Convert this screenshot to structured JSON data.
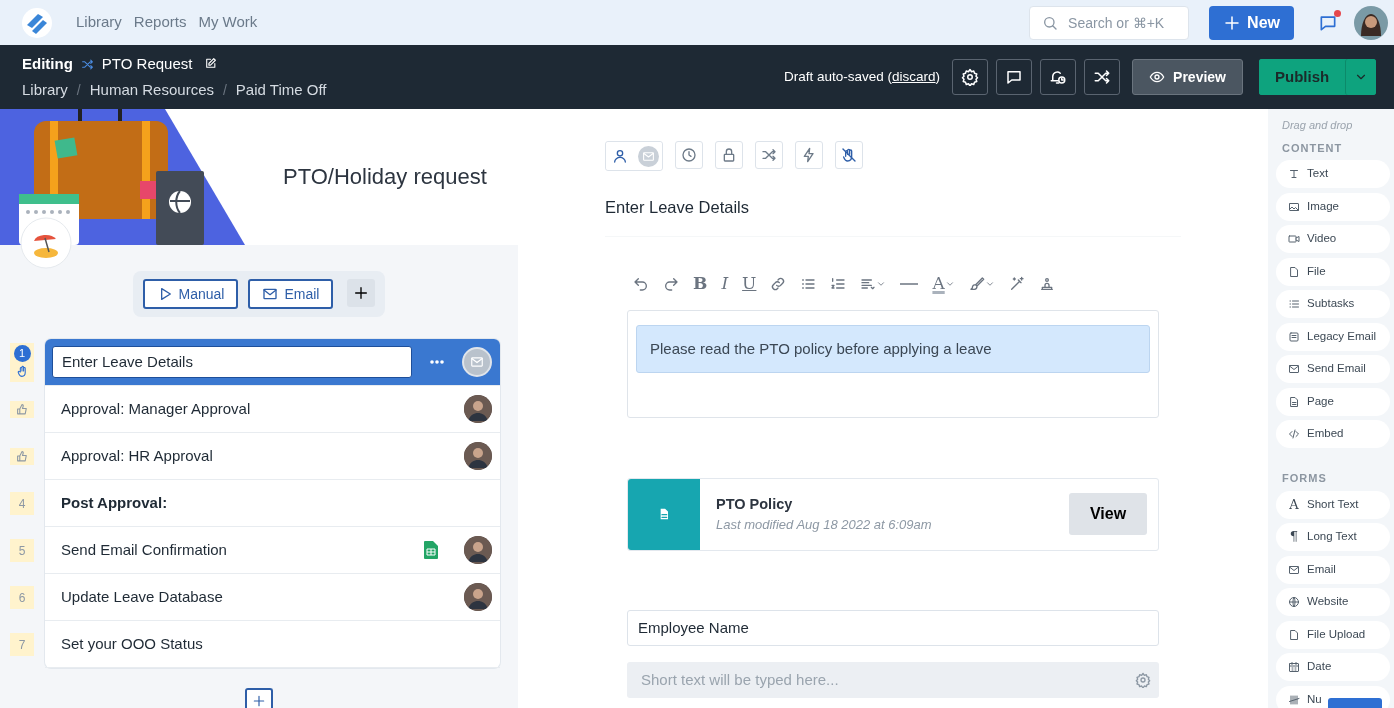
{
  "top_nav": {
    "links": [
      {
        "label": "Library",
        "selected": false
      },
      {
        "label": "Reports",
        "selected": false
      },
      {
        "label": "My Work",
        "selected": false
      }
    ],
    "search": {
      "placeholder": "Search or ⌘+K"
    },
    "new_button": "New",
    "notifications": {
      "unread": true
    }
  },
  "editor_bar": {
    "mode": "Editing",
    "title": "PTO Request",
    "breadcrumb": [
      {
        "kind": "link",
        "label": "Library"
      },
      {
        "kind": "separator",
        "label": "/"
      },
      {
        "kind": "link",
        "label": "Human Resources"
      },
      {
        "kind": "separator",
        "label": "/"
      },
      {
        "kind": "link",
        "label": "Paid Time Off"
      }
    ],
    "autosave": {
      "prefix": "Draft auto-saved (",
      "link": "discard",
      "suffix": ")"
    },
    "preview_button": "Preview",
    "publish_button": "Publish"
  },
  "template": {
    "title": "PTO/Holiday request"
  },
  "triggers": [
    {
      "label": "Manual",
      "kind": "play"
    },
    {
      "label": "Email",
      "kind": "mail"
    }
  ],
  "steps": [
    {
      "marker": "1",
      "kind": "task",
      "label": "Enter Leave Details",
      "selected": true,
      "assignee": {
        "kind": "email"
      }
    },
    {
      "kind": "approval",
      "label": "Approval: Manager Approval",
      "selected": false,
      "assignee": {
        "kind": "person"
      }
    },
    {
      "kind": "approval",
      "label": "Approval: HR Approval",
      "selected": false,
      "assignee": {
        "kind": "person"
      }
    },
    {
      "marker": "4",
      "kind": "heading",
      "label": "Post Approval:",
      "selected": false
    },
    {
      "marker": "5",
      "kind": "task",
      "label": "Send Email Confirmation",
      "selected": false,
      "assignee": {
        "kind": "person"
      },
      "integration": {
        "kind": "spreadsheet"
      }
    },
    {
      "marker": "6",
      "kind": "task",
      "label": "Update Leave Database",
      "selected": false,
      "assignee": {
        "kind": "person"
      }
    },
    {
      "marker": "7",
      "kind": "task",
      "label": "Set your OOO Status",
      "selected": false
    }
  ],
  "task": {
    "title": "Enter Leave Details",
    "toolbar": [
      {
        "kind": "undo"
      },
      {
        "kind": "redo"
      },
      {
        "kind": "bold",
        "glyph": "B"
      },
      {
        "kind": "italic",
        "glyph": "I"
      },
      {
        "kind": "underline",
        "glyph": "U"
      },
      {
        "kind": "link"
      },
      {
        "kind": "bullets"
      },
      {
        "kind": "numbers"
      },
      {
        "kind": "align",
        "menu": true
      },
      {
        "kind": "rule"
      },
      {
        "kind": "text-color",
        "glyph": "A",
        "menu": true
      },
      {
        "kind": "brush",
        "menu": true
      },
      {
        "kind": "wand"
      },
      {
        "kind": "stamp"
      }
    ],
    "callout": "Please read the PTO policy before applying a leave",
    "file": {
      "name": "PTO Policy",
      "modified": "Last modified Aug 18 2022 at 6:09am",
      "button": "View"
    },
    "field": {
      "value": "Employee Name",
      "placeholder": "Short text will be typed here..."
    }
  },
  "palette": {
    "hint": "Drag and drop",
    "sections": [
      {
        "heading": "CONTENT",
        "items": [
          {
            "label": "Text",
            "kind": "text"
          },
          {
            "label": "Image",
            "kind": "image"
          },
          {
            "label": "Video",
            "kind": "video"
          },
          {
            "label": "File",
            "kind": "file"
          },
          {
            "label": "Subtasks",
            "kind": "list"
          },
          {
            "label": "Legacy Email",
            "kind": "legacy"
          },
          {
            "label": "Send Email",
            "kind": "mail"
          },
          {
            "label": "Page",
            "kind": "page"
          },
          {
            "label": "Embed",
            "kind": "code"
          }
        ]
      },
      {
        "heading": "FORMS",
        "items": [
          {
            "label": "Short Text",
            "kind": "glyph",
            "glyph": "A"
          },
          {
            "label": "Long Text",
            "kind": "glyph",
            "glyph": "¶"
          },
          {
            "label": "Email",
            "kind": "mail"
          },
          {
            "label": "Website",
            "kind": "globe"
          },
          {
            "label": "File Upload",
            "kind": "file"
          },
          {
            "label": "Date",
            "kind": "calendar"
          },
          {
            "label": "Nu",
            "kind": "tally"
          }
        ]
      }
    ]
  }
}
